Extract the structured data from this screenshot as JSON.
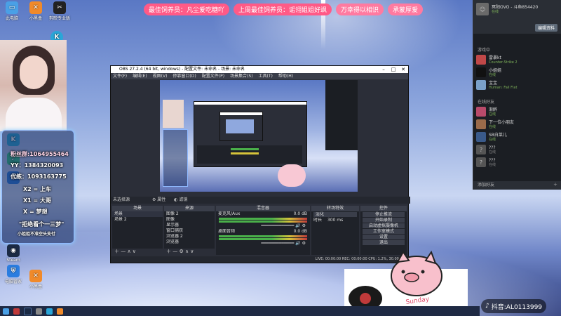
{
  "banner": [
    "最佳饲养员：凡尘爱吃糖吖",
    "上周最佳饲养员：谣翎姐姐好飒",
    "万幸得以相识",
    "承蒙厚爱"
  ],
  "desktop_icons_top": [
    {
      "label": "此电脑",
      "color": "#4aa0e6",
      "glyph": "▭"
    },
    {
      "label": "小黑盒",
      "color": "#f08a2a",
      "glyph": "✕"
    },
    {
      "label": "剪映专业版",
      "color": "#222222",
      "glyph": "✂"
    }
  ],
  "desktop_icons_side": [
    {
      "label": "",
      "color": "#2aa6d8",
      "glyph": "K"
    },
    {
      "label": "QQ音乐",
      "color": "#38c08a",
      "glyph": "♪"
    },
    {
      "label": "",
      "color": "#2a7de0",
      "glyph": "◆"
    }
  ],
  "desktop_icons_bottom": [
    {
      "label": "Steam",
      "color": "#1b2a44",
      "glyph": "◉"
    },
    {
      "label": "电脑管家",
      "color": "#2a7de0",
      "glyph": "⛨"
    },
    {
      "label": "小黑盒",
      "color": "#f08a2a",
      "glyph": "✕"
    }
  ],
  "info_panel": {
    "fans_group": "粉丝群:1064955464",
    "yy": "YY：1384320093",
    "practice": "代练：1093163775",
    "x2": "X2 = 上车",
    "x1": "X1 = 大哥",
    "x": "X = 梦想",
    "slogan": "\"拒绝看个一三梦\"",
    "sub_slogan": "小姐姐不准空头支付"
  },
  "obs": {
    "title": "OBS 27.2.4 (64 bit, windows) - 配置文件: 未命名 - 场景: 未命名",
    "menu": [
      "文件(F)",
      "编辑(E)",
      "视图(V)",
      "停靠窗口(D)",
      "配置文件(P)",
      "场景集合(S)",
      "工具(T)",
      "帮助(H)"
    ],
    "no_source": "未选择源",
    "properties_label": "属性",
    "filters_label": "滤镜",
    "docks": {
      "scenes": {
        "title": "场景",
        "items": [
          "场景",
          "场景 2"
        ]
      },
      "sources": {
        "title": "来源",
        "items": [
          "图像 2",
          "图像",
          "显示器",
          "窗口捕获",
          "浏览器 2",
          "浏览器"
        ]
      },
      "mixer": {
        "title": "混音器",
        "channels": [
          {
            "name": "麦克风/Aux",
            "db": "0.0 dB"
          },
          {
            "name": "桌面音频",
            "db": "0.0 dB"
          }
        ]
      },
      "transitions": {
        "title": "转场特效",
        "type": "淡化",
        "duration_label": "时长",
        "duration": "300 ms"
      },
      "controls": {
        "title": "控件",
        "buttons": [
          "停止推流",
          "开始录制",
          "启动虚拟摄像机",
          "工作室模式",
          "设置",
          "退出"
        ]
      }
    },
    "status": "LIVE: 00:00:00   REC: 00:00:00   CPU: 1.2%, 30.00 fps"
  },
  "chat": {
    "owner": {
      "name": "冥阳OVO - 斗鱼854420",
      "status": "在线"
    },
    "action_button": "编辑资料",
    "playing_label": "游戏中",
    "playing": [
      {
        "name": "雷暴kt",
        "status": "Counter-Strike 2"
      },
      {
        "name": "小姐姐",
        "status": "在线"
      },
      {
        "name": "宝宝",
        "status": "Human: Fall Flat"
      }
    ],
    "online_label": "在线好友",
    "online": [
      {
        "name": "渐醉",
        "status": "在线"
      },
      {
        "name": "下一位小朋友",
        "status": "在线"
      },
      {
        "name": "SB白菜儿",
        "status": "在线"
      },
      {
        "name": "???",
        "status": "在线"
      },
      {
        "name": "???",
        "status": "在线"
      }
    ],
    "footer": "添加好友"
  },
  "sticker": {
    "stamp_text": "Sunday"
  },
  "tiktok": {
    "label": "抖音:AL0113999"
  },
  "colors": {
    "banner_pink": "#ff5a87",
    "obs_bg": "#2b2e38",
    "chat_bg": "#1b1e23"
  }
}
